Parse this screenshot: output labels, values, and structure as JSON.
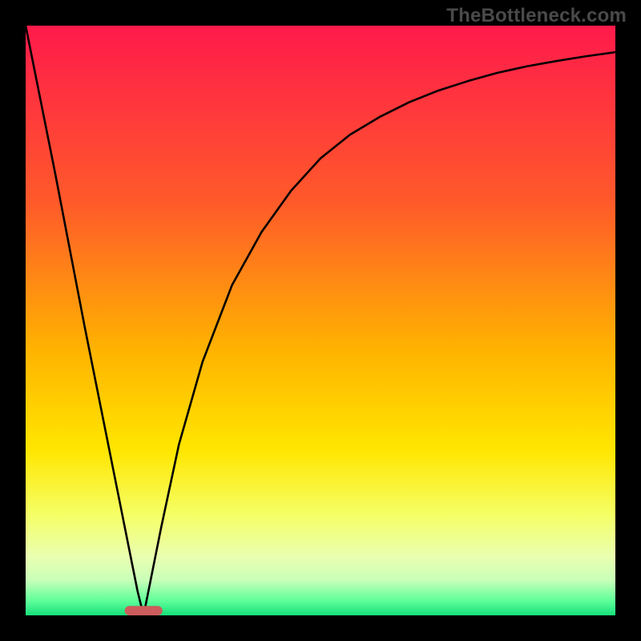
{
  "watermark": "TheBottleneck.com",
  "chart_data": {
    "type": "line",
    "title": "",
    "xlabel": "",
    "ylabel": "",
    "xlim": [
      0,
      100
    ],
    "ylim": [
      0,
      100
    ],
    "gradient_stops": [
      {
        "offset": 0,
        "color": "#ff1a4b"
      },
      {
        "offset": 0.3,
        "color": "#ff5a2a"
      },
      {
        "offset": 0.55,
        "color": "#ffb300"
      },
      {
        "offset": 0.72,
        "color": "#ffe600"
      },
      {
        "offset": 0.83,
        "color": "#f5ff66"
      },
      {
        "offset": 0.9,
        "color": "#eaffb0"
      },
      {
        "offset": 0.94,
        "color": "#c9ffb8"
      },
      {
        "offset": 0.975,
        "color": "#5fff9a"
      },
      {
        "offset": 1.0,
        "color": "#16e07a"
      }
    ],
    "curve": {
      "x": [
        0,
        5,
        10,
        15,
        17,
        19,
        20,
        21,
        23,
        26,
        30,
        35,
        40,
        45,
        50,
        55,
        60,
        65,
        70,
        75,
        80,
        85,
        90,
        95,
        100
      ],
      "y": [
        100,
        75,
        49,
        24,
        14,
        4,
        0,
        5,
        15,
        29,
        43,
        56,
        65,
        72,
        77.5,
        81.5,
        84.5,
        87,
        89,
        90.6,
        92,
        93.1,
        94,
        94.8,
        95.5
      ]
    },
    "optimum_marker": {
      "x_center": 20,
      "x_halfwidth": 3.2,
      "y": 0,
      "height": 1.6,
      "color": "#cd5c5c"
    }
  }
}
